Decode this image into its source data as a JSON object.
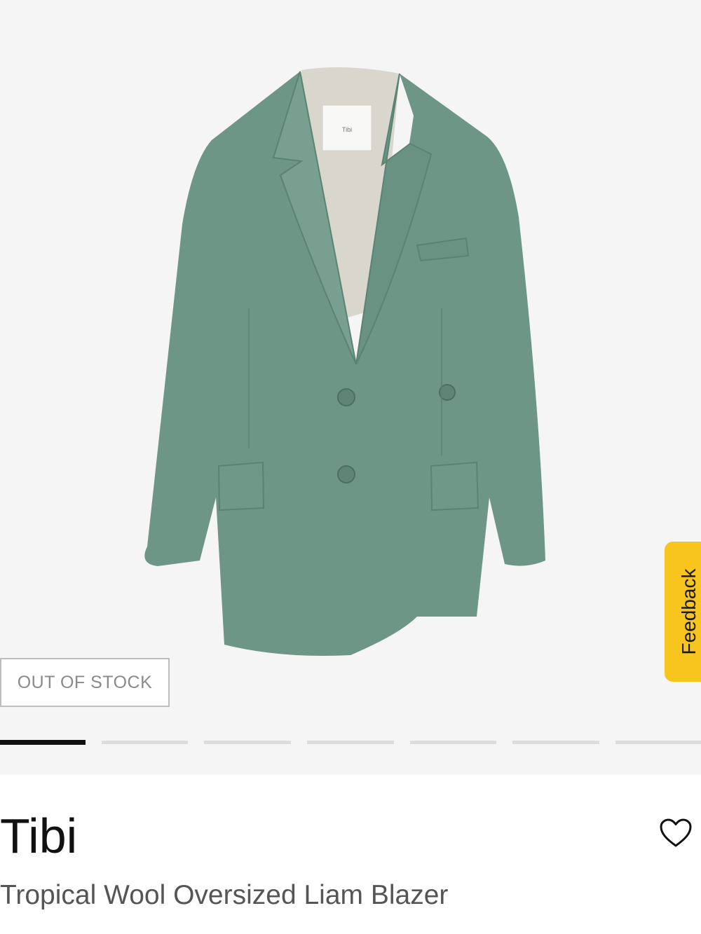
{
  "gallery": {
    "badge": "OUT OF STOCK",
    "image_alt": "Tropical Wool Oversized Liam Blazer",
    "label_text": "Tibi",
    "slide_count": 7,
    "active_slide": 1
  },
  "feedback": {
    "label": "Feedback"
  },
  "product": {
    "brand": "Tibi",
    "name": "Tropical Wool Oversized Liam Blazer",
    "color": "#6f9788"
  },
  "icons": {
    "wishlist": "heart-icon"
  }
}
